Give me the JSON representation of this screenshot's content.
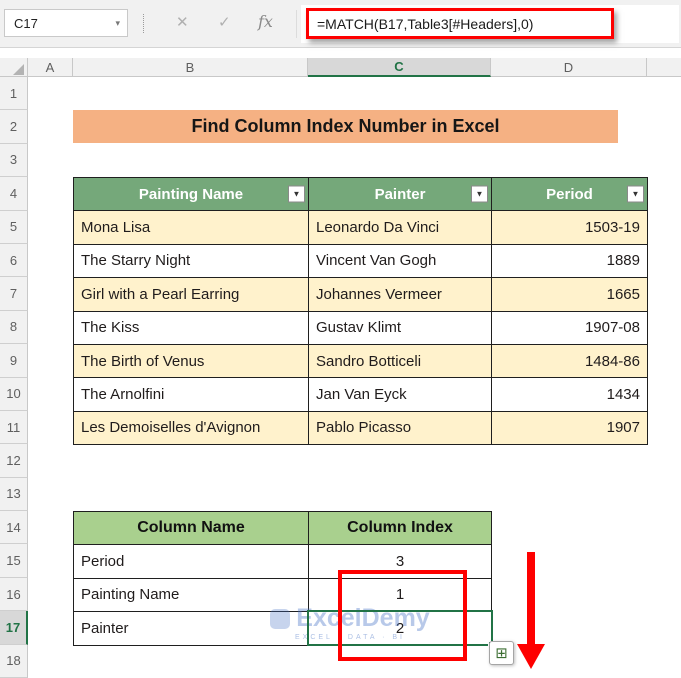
{
  "app": {
    "name_box": "C17",
    "name_box_arrow": "▾",
    "cancel_icon": "✕",
    "enter_icon": "✓",
    "fx_label": "fx",
    "formula": "=MATCH(B17,Table3[#Headers],0)"
  },
  "grid": {
    "columns": [
      "A",
      "B",
      "C",
      "D"
    ],
    "rows": [
      "1",
      "2",
      "3",
      "4",
      "5",
      "6",
      "7",
      "8",
      "9",
      "10",
      "11",
      "12",
      "13",
      "14",
      "15",
      "16",
      "17",
      "18"
    ],
    "selected_cell": "C17"
  },
  "banner": {
    "title": "Find Column Index Number in Excel"
  },
  "paintings_table": {
    "headers": [
      "Painting Name",
      "Painter",
      "Period"
    ],
    "rows": [
      [
        "Mona Lisa",
        "Leonardo Da Vinci",
        "1503-19"
      ],
      [
        "The Starry Night",
        "Vincent Van Gogh",
        "1889"
      ],
      [
        "Girl with a Pearl Earring",
        "Johannes Vermeer",
        "1665"
      ],
      [
        "The Kiss",
        "Gustav Klimt",
        "1907-08"
      ],
      [
        "The Birth of Venus",
        "Sandro Botticeli",
        "1484-86"
      ],
      [
        "The Arnolfini",
        "Jan Van Eyck",
        "1434"
      ],
      [
        "Les Demoiselles d'Avignon",
        "Pablo Picasso",
        "1907"
      ]
    ]
  },
  "index_table": {
    "headers": [
      "Column Name",
      "Column Index"
    ],
    "rows": [
      [
        "Period",
        "3"
      ],
      [
        "Painting Name",
        "1"
      ],
      [
        "Painter",
        "2"
      ]
    ]
  },
  "icons": {
    "filter": "▼",
    "autofill": "⊞"
  },
  "watermark": {
    "brand": "ExcelDemy",
    "tagline": "EXCEL · DATA · BI"
  },
  "colors": {
    "accent_green": "#217346",
    "table_header_green": "#75A87A",
    "light_green": "#A9D08E",
    "banner_peach": "#F5B183",
    "row_cream": "#FFF2CC",
    "annotation_red": "#FE0000"
  }
}
